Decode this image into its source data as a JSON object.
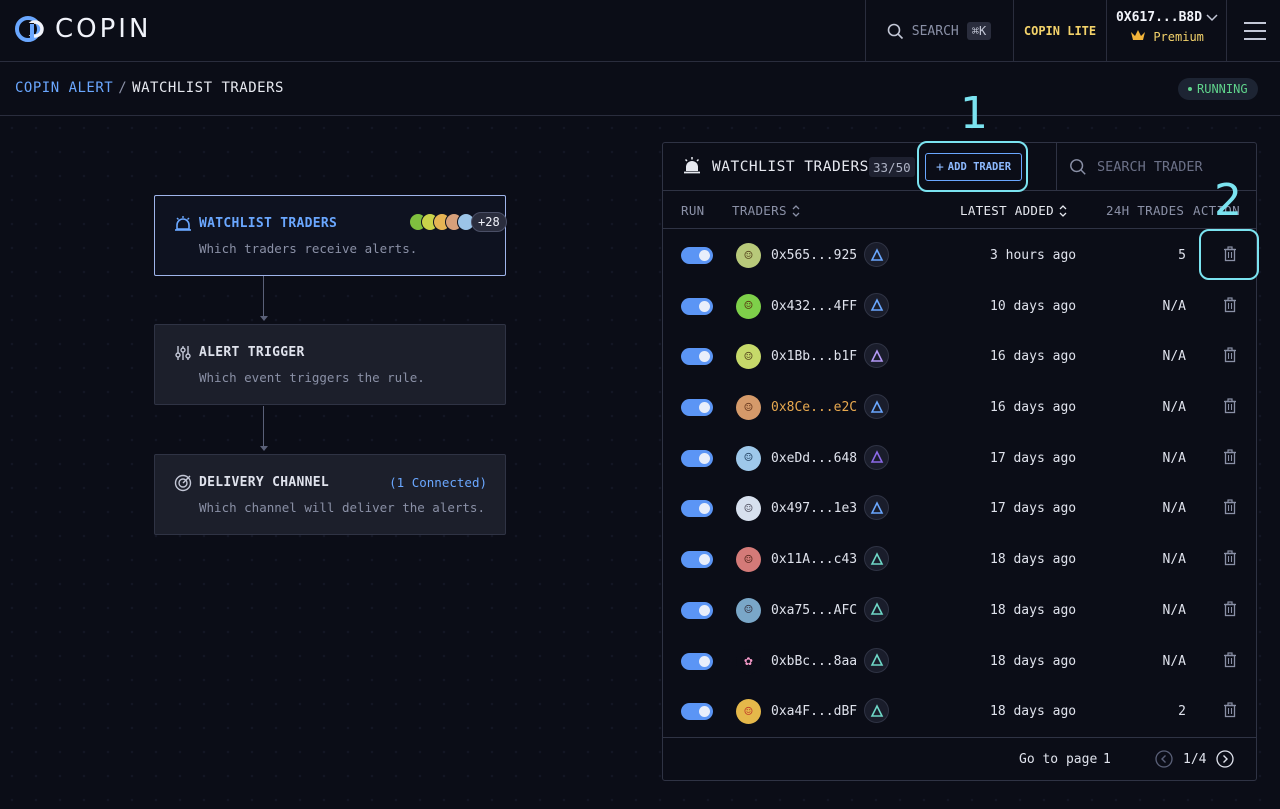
{
  "header": {
    "logo_text": "COPIN",
    "search_label": "SEARCH",
    "search_shortcut": "⌘K",
    "lite_label": "COPIN LITE",
    "wallet_address": "0X617...B8D",
    "wallet_tier": "Premium"
  },
  "breadcrumb": {
    "parent": "COPIN ALERT",
    "separator": "/",
    "current": "WATCHLIST TRADERS"
  },
  "status_badge": "RUNNING",
  "flow": {
    "watchlist": {
      "title": "WATCHLIST TRADERS",
      "desc": "Which traders receive alerts.",
      "more_count": "+28"
    },
    "trigger": {
      "title": "ALERT TRIGGER",
      "desc": "Which event triggers the rule."
    },
    "delivery": {
      "title": "DELIVERY CHANNEL",
      "desc": "Which channel will deliver the alerts.",
      "connected": "(1 Connected)"
    }
  },
  "panel": {
    "title": "WATCHLIST TRADERS",
    "count": "33/50",
    "add_button": "ADD TRADER",
    "search_placeholder": "SEARCH TRADER",
    "columns": {
      "run": "RUN",
      "traders": "TRADERS",
      "latest_added": "LATEST ADDED",
      "trades_24h": "24H TRADES",
      "action": "ACTION"
    },
    "rows": [
      {
        "address": "0x565...925",
        "added": "3 hours ago",
        "trades": "5"
      },
      {
        "address": "0x432...4FF",
        "added": "10 days ago",
        "trades": "N/A"
      },
      {
        "address": "0x1Bb...b1F",
        "added": "16 days ago",
        "trades": "N/A"
      },
      {
        "address": "0x8Ce...e2C",
        "added": "16 days ago",
        "trades": "N/A"
      },
      {
        "address": "0xeDd...648",
        "added": "17 days ago",
        "trades": "N/A"
      },
      {
        "address": "0x497...1e3",
        "added": "17 days ago",
        "trades": "N/A"
      },
      {
        "address": "0x11A...c43",
        "added": "18 days ago",
        "trades": "N/A"
      },
      {
        "address": "0xa75...AFC",
        "added": "18 days ago",
        "trades": "N/A"
      },
      {
        "address": "0xbBc...8aa",
        "added": "18 days ago",
        "trades": "N/A"
      },
      {
        "address": "0xa4F...dBF",
        "added": "18 days ago",
        "trades": "2"
      }
    ],
    "pager": {
      "label": "Go to page",
      "page_value": "1",
      "info": "1/4"
    }
  },
  "annotations": {
    "one": "1",
    "two": "2"
  },
  "colors": {
    "accent": "#6aa7ff",
    "annotation": "#7be3f0",
    "running": "#5fd38b",
    "premium": "#f3d26a"
  }
}
